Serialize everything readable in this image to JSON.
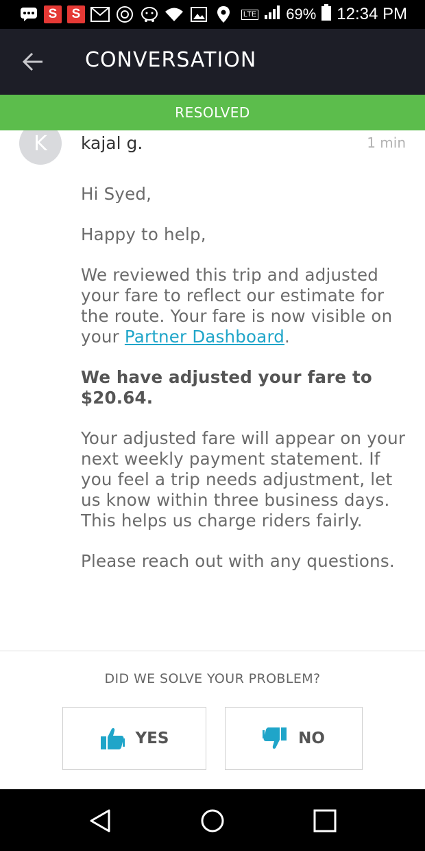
{
  "status_bar": {
    "battery": "69%",
    "time": "12:34 PM",
    "network": "LTE",
    "app_badges": [
      "S",
      "S"
    ]
  },
  "toolbar": {
    "title": "CONVERSATION"
  },
  "banner": {
    "label": "RESOLVED",
    "color": "#5cbd4c"
  },
  "message": {
    "avatar_initial": "K",
    "sender": "kajal g.",
    "time": "1 min",
    "greeting": "Hi Syed,",
    "happy": "Happy to help,",
    "reviewed_text": "We reviewed this trip and adjusted your fare to reflect our estimate for the route. Your fare is now visible on your ",
    "link_text": "Partner Dashboard",
    "period": ".",
    "adjusted_line": "We have adjusted your fare to $20.64.",
    "payment_text": "Your adjusted fare will appear on your next weekly payment statement. If you feel a trip needs adjustment, let us know within three business days. This helps us charge riders fairly.",
    "closing": "Please reach out with any questions."
  },
  "feedback": {
    "question": "DID WE SOLVE YOUR PROBLEM?",
    "yes_label": "YES",
    "no_label": "NO",
    "icon_color": "#1fa5c9"
  },
  "colors": {
    "toolbar": "#1d1e27",
    "link": "#1fa5c9"
  }
}
